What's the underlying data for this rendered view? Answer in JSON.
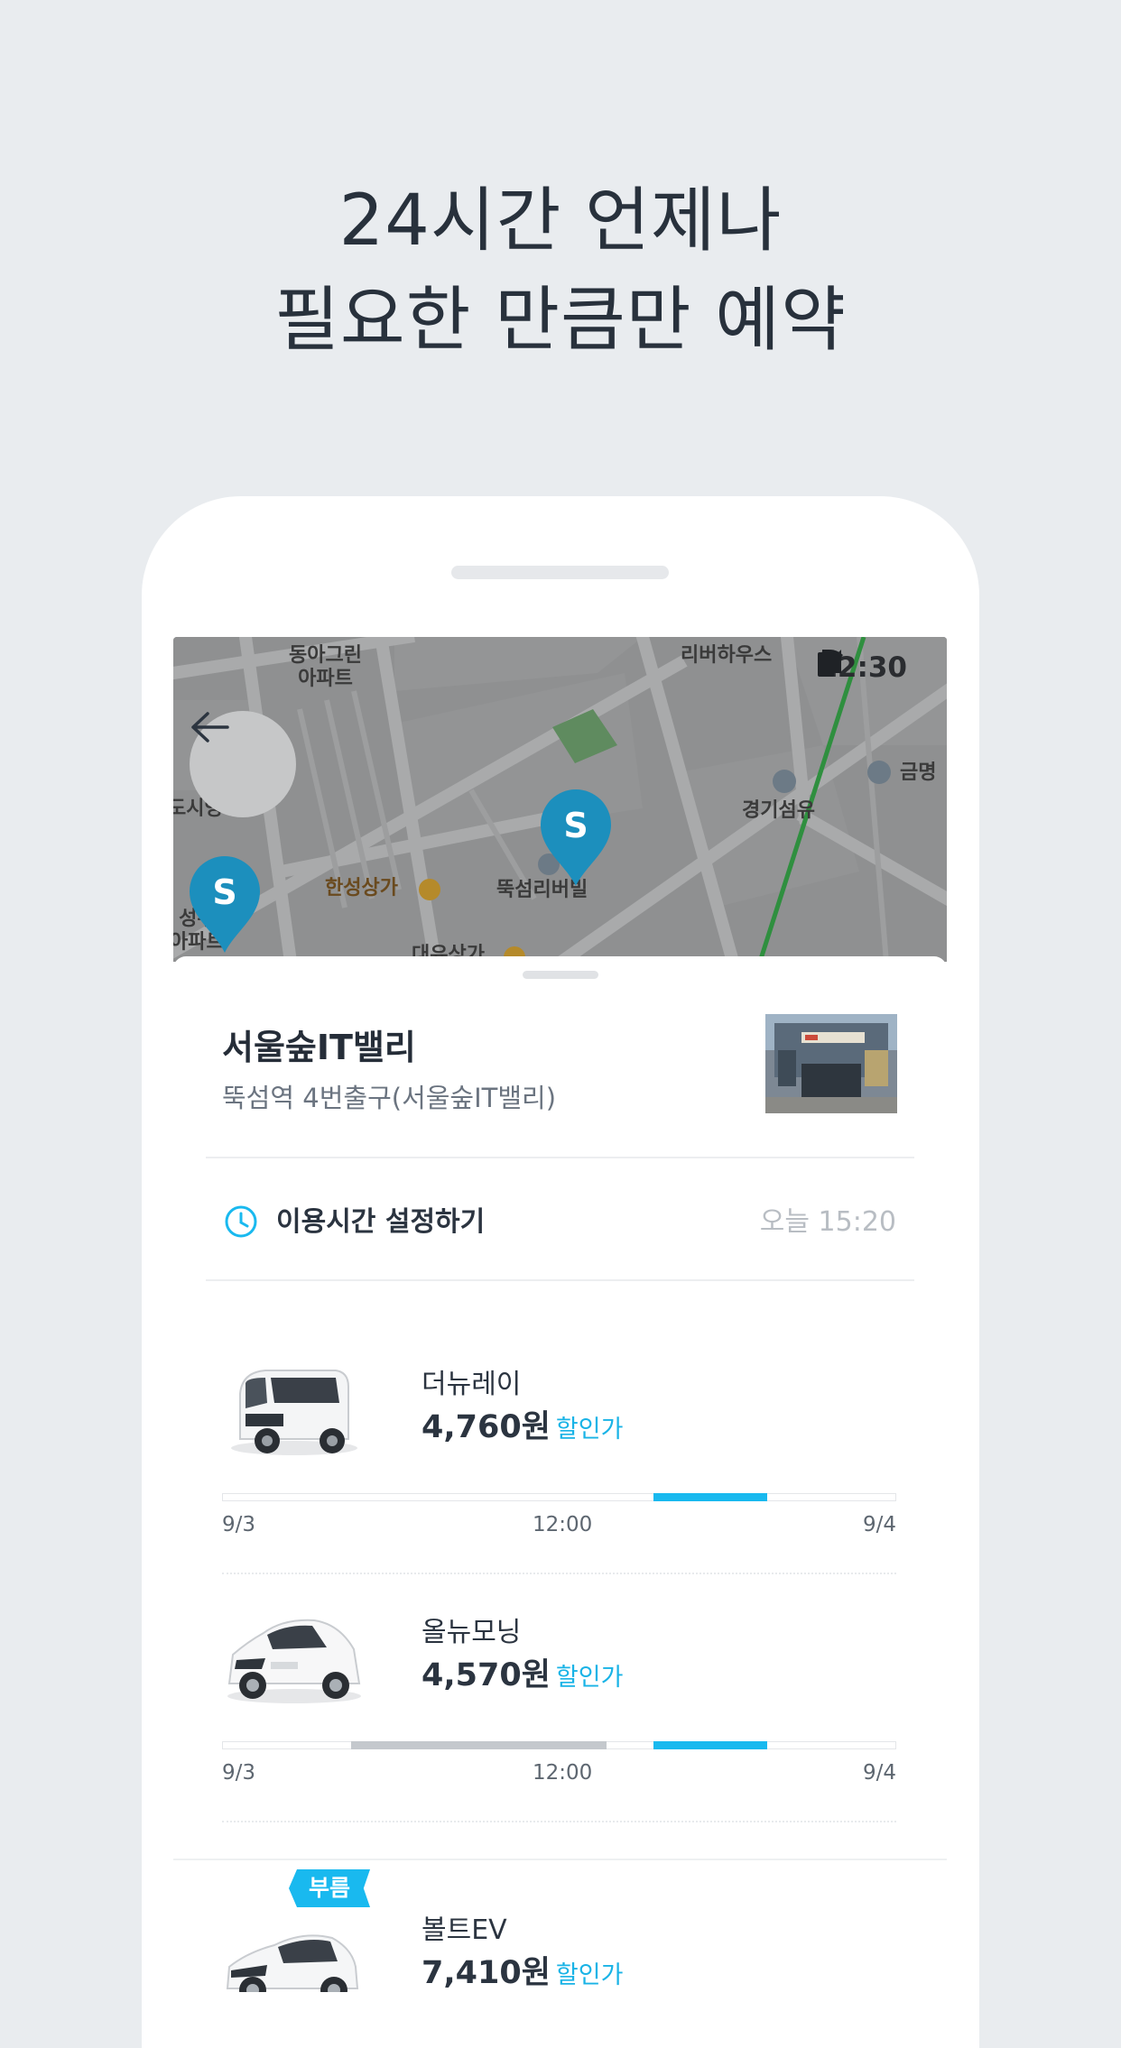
{
  "headline": {
    "line1": "24시간 언제나",
    "line2": "필요한 만큼만 예약"
  },
  "status_bar": {
    "time": "12:30"
  },
  "map": {
    "labels": {
      "dong_a": "동아그린\n아파트",
      "river_house": "리버하우스",
      "geummyeong": "금명",
      "gyeonggi": "경기섬유",
      "city": "도시영",
      "hanseong": "한성상가",
      "ttukseom": "뚝섬리버빌",
      "apart2": "성수\n아파트",
      "daeyu": "대유상가"
    },
    "pin_letter": "S"
  },
  "place": {
    "name": "서울숲IT밸리",
    "address": "뚝섬역 4번출구(서울숲IT밸리)"
  },
  "time_setting": {
    "label": "이용시간 설정하기",
    "value": "오늘 15:20"
  },
  "cars": [
    {
      "name": "더뉴레이",
      "price": "4,760원",
      "discount": "할인가",
      "timeline": {
        "start": "9/3",
        "mid": "12:00",
        "end": "9/4"
      },
      "booked": [],
      "selected": [
        [
          0.64,
          0.81
        ]
      ]
    },
    {
      "name": "올뉴모닝",
      "price": "4,570원",
      "discount": "할인가",
      "timeline": {
        "start": "9/3",
        "mid": "12:00",
        "end": "9/4"
      },
      "booked": [
        [
          0.19,
          0.57
        ]
      ],
      "selected": [
        [
          0.64,
          0.81
        ]
      ]
    },
    {
      "name": "볼트EV",
      "price": "7,410원",
      "discount": "할인가",
      "badge": "부름"
    }
  ],
  "colors": {
    "accent": "#19b9ef",
    "text": "#2b3440",
    "background": "#e9ecef"
  }
}
